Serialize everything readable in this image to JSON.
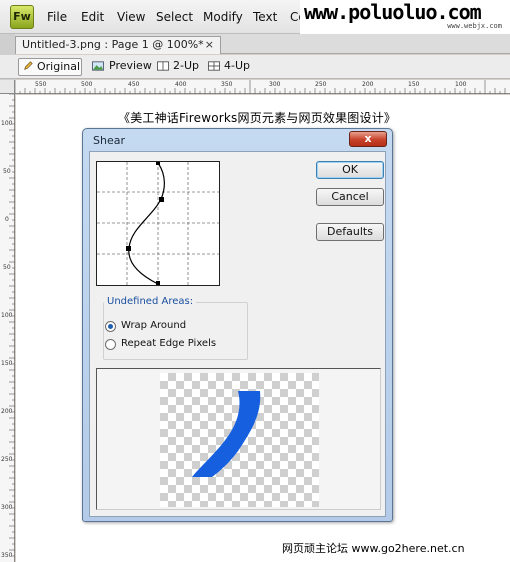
{
  "app": {
    "logo_text": "Fw"
  },
  "menu": [
    "File",
    "Edit",
    "View",
    "Select",
    "Modify",
    "Text",
    "Co"
  ],
  "watermark": {
    "text": "www.poluoluo.com",
    "sub": "www.webjx.com"
  },
  "document": {
    "tab_title": "Untitled-3.png : Page 1 @ 100%*",
    "tab_close": "×"
  },
  "view_modes": [
    {
      "label": "Original",
      "icon": "pencil-icon",
      "active": true
    },
    {
      "label": "Preview",
      "icon": "image-icon",
      "active": false
    },
    {
      "label": "2-Up",
      "icon": "two-up-icon",
      "active": false
    },
    {
      "label": "4-Up",
      "icon": "four-up-icon",
      "active": false
    }
  ],
  "rulers": {
    "horizontal": [
      "550",
      "500",
      "450",
      "400",
      "350",
      "300",
      "250",
      "200",
      "150",
      "100"
    ],
    "vertical": [
      "100",
      "50",
      "0",
      "50",
      "100",
      "150",
      "200",
      "250",
      "300",
      "350"
    ]
  },
  "canvas": {
    "headline": "《美工神话Fireworks网页元素与网页效果图设计》",
    "footer": "网页顽主论坛 www.go2here.net.cn"
  },
  "dialog": {
    "title": "Shear",
    "close_label": "x",
    "ok_label": "OK",
    "cancel_label": "Cancel",
    "defaults_label": "Defaults",
    "undefined_areas_label": "Undefined Areas:",
    "options": [
      {
        "label": "Wrap Around",
        "selected": true
      },
      {
        "label": "Repeat Edge Pixels",
        "selected": false
      }
    ],
    "accent_color": "#1660e0"
  }
}
